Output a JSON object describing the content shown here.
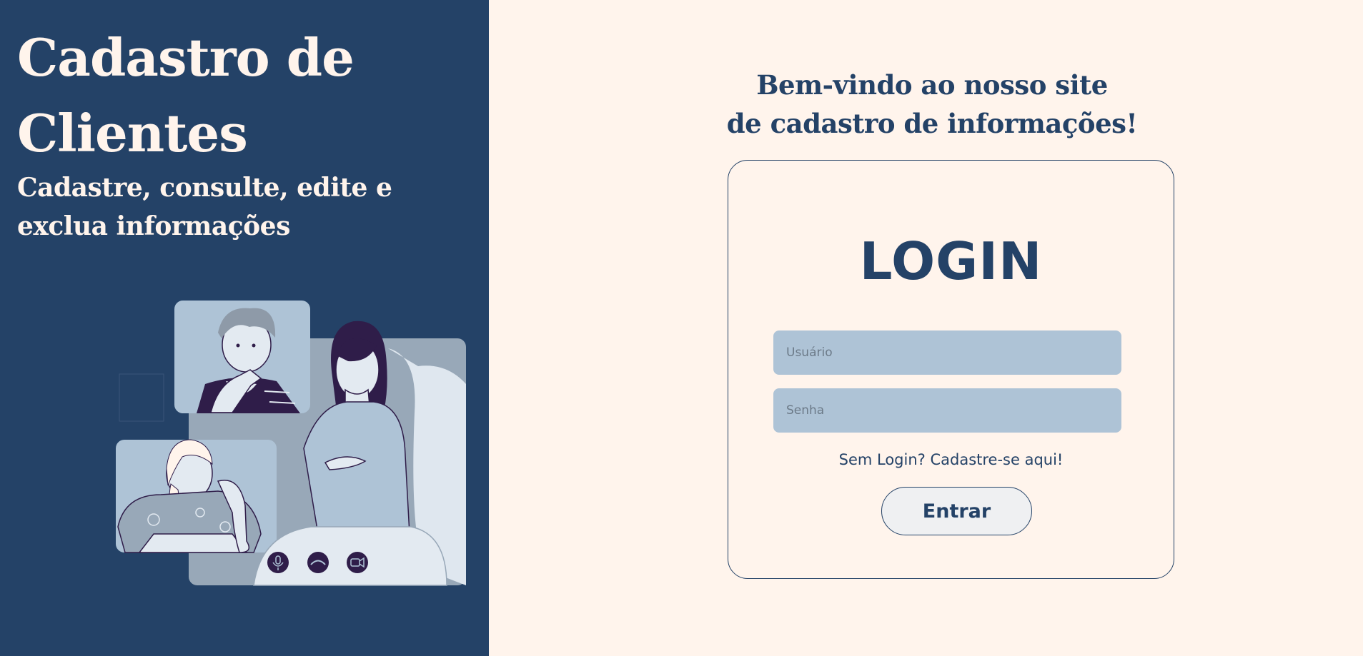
{
  "hero": {
    "title": "Cadastro de Clientes",
    "subtitle": "Cadastre, consulte, edite e exclua informações"
  },
  "welcome": {
    "line1": "Bem-vindo ao nosso site",
    "line2": "de cadastro de informações!"
  },
  "login": {
    "title": "LOGIN",
    "username_placeholder": "Usuário",
    "username_value": "",
    "password_placeholder": "Senha",
    "password_value": "",
    "signup_link": "Sem Login? Cadastre-se aqui!",
    "submit_label": "Entrar"
  },
  "illustration": {
    "description_icons": [
      "microphone-icon",
      "hang-up-icon",
      "video-camera-icon"
    ]
  },
  "colors": {
    "navy": "#244267",
    "cream": "#fff4ec",
    "input_blue": "#aec3d6",
    "button_bg": "#eff0f2"
  }
}
